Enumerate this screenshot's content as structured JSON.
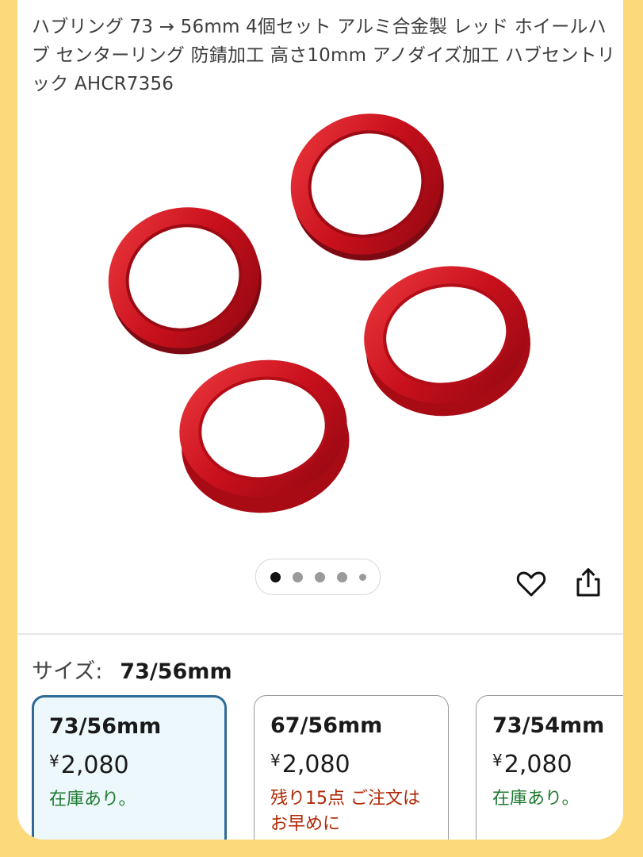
{
  "product": {
    "title": "ハブリング 73 → 56mm 4個セット アルミ合金製 レッド ホイールハブ センターリング 防錆加工 高さ10mm アノダイズ加工 ハブセントリック AHCR7356"
  },
  "gallery": {
    "image_count": 5,
    "active_index": 0,
    "image_desc": "four-red-anodized-hub-rings"
  },
  "actions": {
    "favorite_icon": "heart-icon",
    "share_icon": "share-icon"
  },
  "size_selector": {
    "label": "サイズ:",
    "selected_value": "73/56mm",
    "variants": [
      {
        "name": "73/56mm",
        "currency": "¥",
        "price": "2,080",
        "stock": "在庫あり。",
        "stock_status": "in-stock",
        "selected": true
      },
      {
        "name": "67/56mm",
        "currency": "¥",
        "price": "2,080",
        "stock": "残り15点 ご注文はお早めに",
        "stock_status": "low-stock",
        "selected": false
      },
      {
        "name": "73/54mm",
        "currency": "¥",
        "price": "2,080",
        "stock": "在庫あり。",
        "stock_status": "in-stock",
        "selected": false
      }
    ]
  },
  "colors": {
    "page_background": "#fcd97a",
    "selected_border": "#2f6a96",
    "selected_fill": "#edf8fd",
    "in_stock": "#1f7a2f",
    "low_stock": "#b12704",
    "ring_red": "#c8101c"
  }
}
